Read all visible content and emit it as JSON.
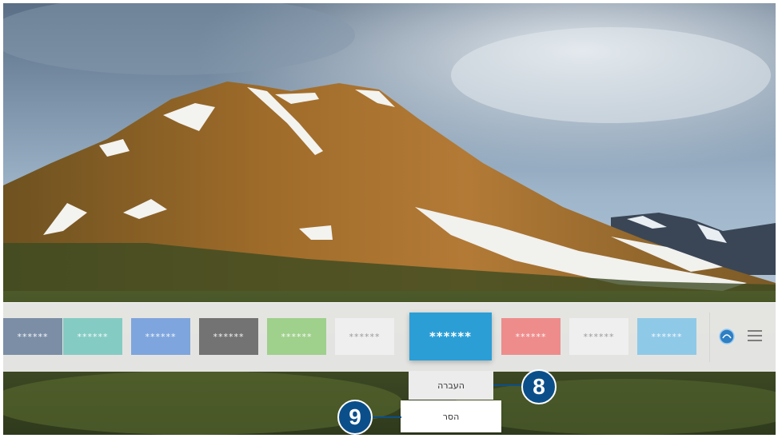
{
  "app_bar": {
    "tiles": [
      {
        "label": "******",
        "color": "#7b8ea6"
      },
      {
        "label": "******",
        "color": "#84cbc3"
      },
      {
        "label": "******",
        "color": "#7ea5dd"
      },
      {
        "label": "******",
        "color": "#737373"
      },
      {
        "label": "******",
        "color": "#9fd08c"
      },
      {
        "label": "******",
        "color": "#efefef"
      },
      {
        "label": "******",
        "color": "#2b9ed6",
        "focused": true
      },
      {
        "label": "******",
        "color": "#ee8c8c"
      },
      {
        "label": "******",
        "color": "#efefef"
      },
      {
        "label": "******",
        "color": "#8fc9e8"
      }
    ],
    "icons": [
      "source-icon",
      "menu-icon"
    ]
  },
  "context_menu": {
    "move_label": "העברה",
    "remove_label": "הסר"
  },
  "callouts": {
    "move_number": "8",
    "remove_number": "9",
    "color": "#0b4f8a"
  }
}
